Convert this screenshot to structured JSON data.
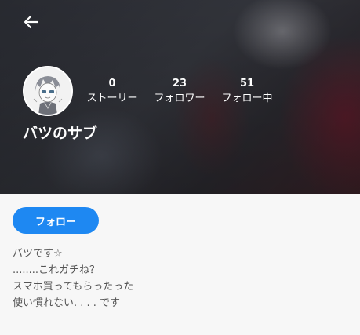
{
  "header": {
    "back_icon": "arrow-left-icon"
  },
  "profile": {
    "name": "バツのサブ",
    "avatar_icon": "avatar-drawing",
    "stats": [
      {
        "value": "0",
        "label": "ストーリー"
      },
      {
        "value": "23",
        "label": "フォロワー"
      },
      {
        "value": "51",
        "label": "フォロー中"
      }
    ]
  },
  "actions": {
    "follow_label": "フォロー"
  },
  "bio": {
    "lines": [
      "バツです☆",
      "........これガチね？",
      "スマホ買ってもらったった",
      "使い慣れない. . . . です"
    ]
  },
  "colors": {
    "accent": "#1e88f2",
    "text": "#555555",
    "background": "#f7f7f7"
  }
}
